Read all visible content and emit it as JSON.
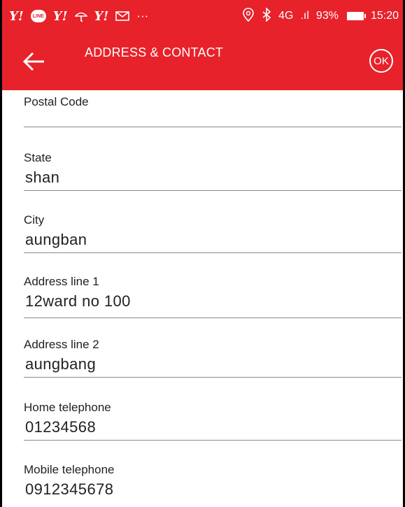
{
  "statusbar": {
    "right_network": "4G",
    "signal": ".ıl",
    "battery": "93%",
    "time": "15:20",
    "left_icons": [
      "yahoo-icon",
      "line-icon",
      "yahoo-icon",
      "umbrella-icon",
      "yahoo-icon",
      "mail-icon",
      "more-icon"
    ],
    "right_icons": [
      "location-icon",
      "bluetooth-icon",
      "network-icon",
      "signal-icon",
      "battery-icon"
    ],
    "ellipsis": "···",
    "accent": "#e8222a"
  },
  "appbar": {
    "title": "ADDRESS & CONTACT",
    "ok_label": "OK",
    "back_icon": "back-arrow-icon"
  },
  "form": {
    "postal_code": {
      "label": "Postal Code",
      "value": ""
    },
    "state": {
      "label": "State",
      "value": "shan"
    },
    "city": {
      "label": "City",
      "value": "aungban"
    },
    "address1": {
      "label": "Address line 1",
      "value": "12ward no 100"
    },
    "address2": {
      "label": "Address line 2",
      "value": "aungbang"
    },
    "home_phone": {
      "label": "Home telephone",
      "value": "01234568"
    },
    "mobile_phone": {
      "label": "Mobile telephone",
      "value": "0912345678"
    }
  }
}
